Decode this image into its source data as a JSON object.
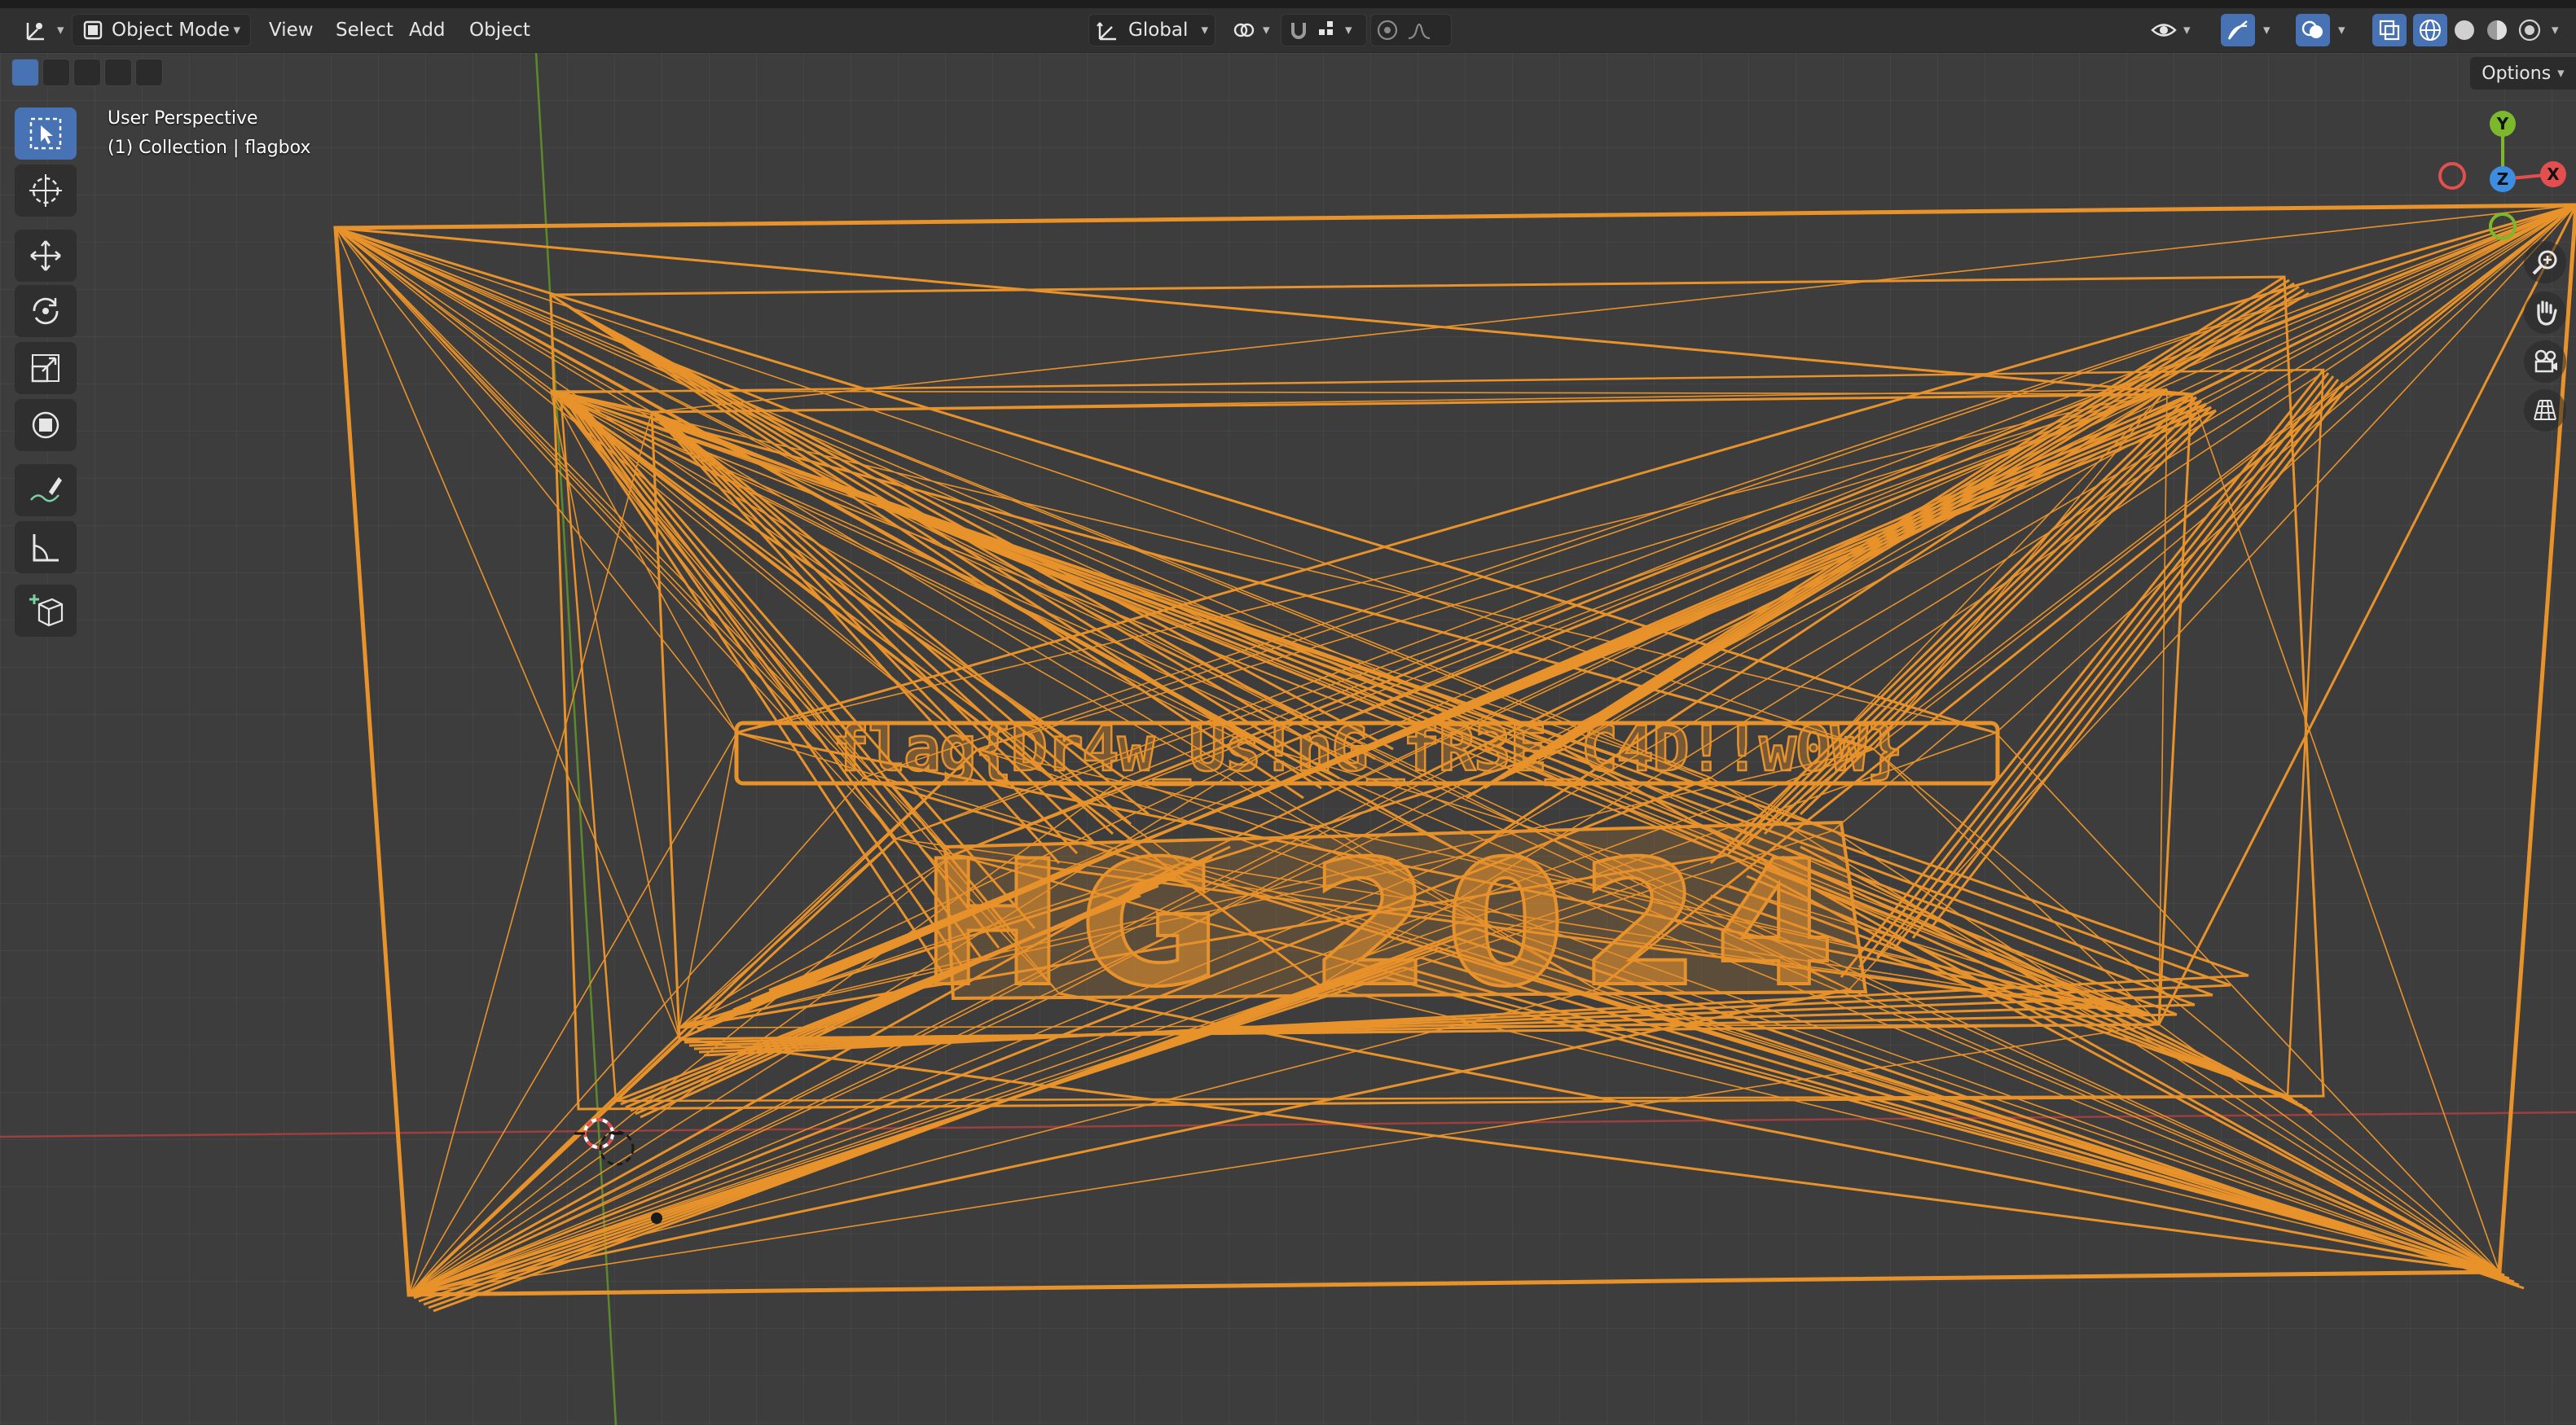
{
  "header": {
    "editor_type_icon": "transform-icon",
    "mode": "Object Mode",
    "menus": [
      "View",
      "Select",
      "Add",
      "Object"
    ],
    "orientation": "Global"
  },
  "toolbar_row2": {
    "options": "Options"
  },
  "viewport": {
    "view_name": "User Perspective",
    "collection_info": "(1) Collection | flagbox",
    "scene_text_top": "flag{Dr4w_Us!nG_fR3E_C4D!!w0W}",
    "scene_text_bottom": "HG 2024",
    "gizmo": {
      "y": "Y",
      "z": "Z",
      "x": "X"
    }
  },
  "tools": [
    "select-box-icon",
    "cursor-icon",
    "move-icon",
    "rotate-icon",
    "scale-icon",
    "transform-icon",
    "annotate-icon",
    "measure-icon",
    "add-cube-icon"
  ],
  "colors": {
    "accent": "#4772b3",
    "wire": "#e8922b",
    "x_axis": "#e34f4f",
    "y_axis": "#7cb82c",
    "z_axis": "#3d8de0",
    "viewport_bg": "#3d3d3d",
    "header_bg": "#303030"
  }
}
